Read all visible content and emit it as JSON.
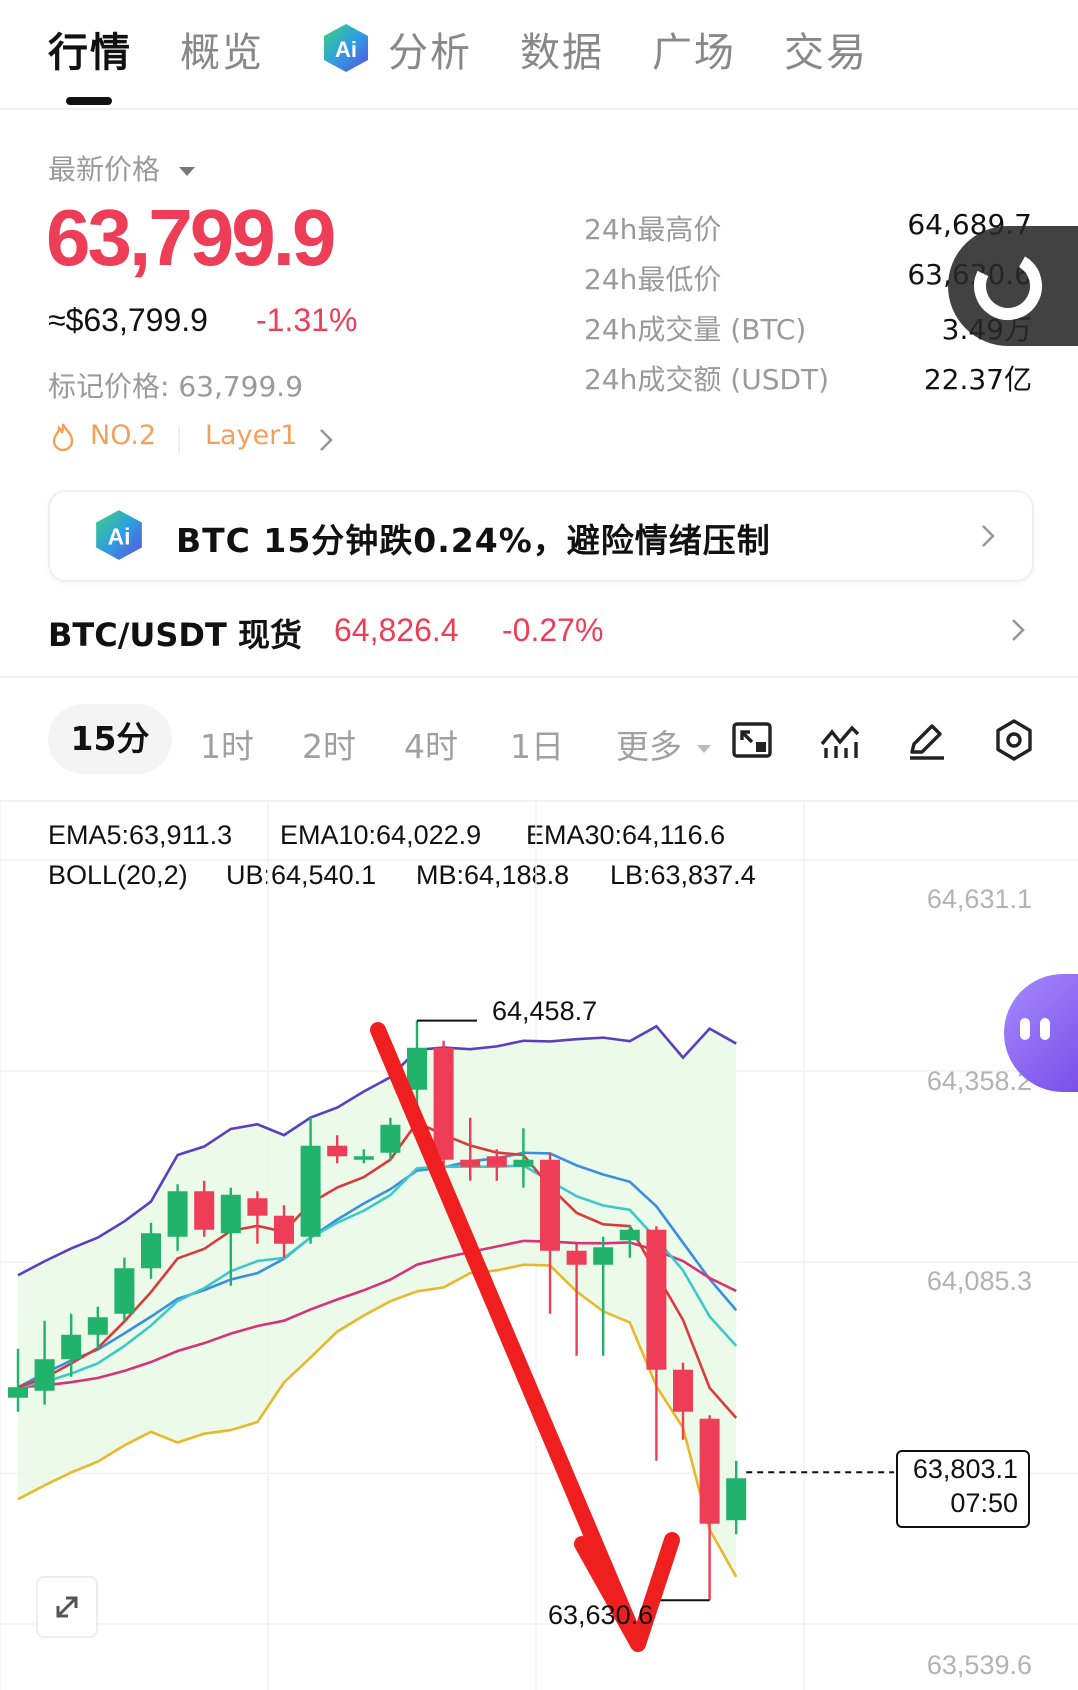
{
  "nav": {
    "tabs": [
      "行情",
      "概览",
      "分析",
      "数据",
      "广场",
      "交易"
    ],
    "active": "行情"
  },
  "price": {
    "latest_label": "最新价格",
    "last": "63,799.9",
    "usd": "≈$63,799.9",
    "change": "-1.31%",
    "mark": "标记价格: 63,799.9",
    "rank": "NO.2",
    "category": "Layer1"
  },
  "stats": [
    {
      "label": "24h最高价",
      "value": "64,689.7"
    },
    {
      "label": "24h最低价",
      "value": "63,630.6"
    },
    {
      "label": "24h成交量 (BTC)",
      "value": "3.49万"
    },
    {
      "label": "24h成交额 (USDT)",
      "value": "22.37亿"
    }
  ],
  "ai_banner": {
    "text": "BTC 15分钟跌0.24%，避险情绪压制"
  },
  "pair": {
    "name": "BTC/USDT 现货",
    "price": "64,826.4",
    "change": "-0.27%"
  },
  "intervals": [
    "15分",
    "1时",
    "2时",
    "4时",
    "1日",
    "更多"
  ],
  "active_interval": "15分",
  "indicators": {
    "ema5": "EMA5:63,911.3",
    "ema10": "EMA10:64,022.9",
    "ema30": "EMA30:64,116.6",
    "boll": "BOLL(20,2)",
    "ub": "UB:64,540.1",
    "mb": "MB:64,188.8",
    "lb": "LB:63,837.4"
  },
  "colors": {
    "up": "#21b26b",
    "down": "#ee3d57",
    "ema5": "#d93a3a",
    "ema10": "#3dc9c9",
    "ema30": "#d6337a",
    "boll": "#e0a431",
    "ub": "#5b3fbf",
    "mb": "#3a8fe0",
    "lb": "#e8b82a",
    "arrow": "#f01f1f"
  },
  "chart_data": {
    "type": "candlestick",
    "y_axis_ticks": [
      "64,631.1",
      "64,358.2",
      "64,085.3",
      "63,539.6"
    ],
    "high_marker": "64,458.7",
    "low_marker": "63,630.6",
    "current_price": "63,803.1",
    "countdown": "07:50",
    "candles": [
      {
        "o": 63920,
        "h": 63990,
        "c": 63935,
        "l": 63900
      },
      {
        "o": 63930,
        "h": 64030,
        "c": 63975,
        "l": 63910
      },
      {
        "o": 63975,
        "h": 64040,
        "c": 64010,
        "l": 63950
      },
      {
        "o": 64010,
        "h": 64050,
        "c": 64035,
        "l": 63990
      },
      {
        "o": 64040,
        "h": 64120,
        "c": 64105,
        "l": 64030
      },
      {
        "o": 64105,
        "h": 64170,
        "c": 64155,
        "l": 64090
      },
      {
        "o": 64150,
        "h": 64225,
        "c": 64215,
        "l": 64130
      },
      {
        "o": 64215,
        "h": 64230,
        "c": 64160,
        "l": 64150
      },
      {
        "o": 64155,
        "h": 64220,
        "c": 64210,
        "l": 64080
      },
      {
        "o": 64205,
        "h": 64215,
        "c": 64180,
        "l": 64140
      },
      {
        "o": 64180,
        "h": 64195,
        "c": 64140,
        "l": 64120
      },
      {
        "o": 64150,
        "h": 64320,
        "c": 64280,
        "l": 64140
      },
      {
        "o": 64280,
        "h": 64295,
        "c": 64265,
        "l": 64255
      },
      {
        "o": 64260,
        "h": 64275,
        "c": 64265,
        "l": 64255
      },
      {
        "o": 64270,
        "h": 64320,
        "c": 64310,
        "l": 64260
      },
      {
        "o": 64360,
        "h": 64458.7,
        "c": 64420,
        "l": 64300
      },
      {
        "o": 64420,
        "h": 64430,
        "c": 64260,
        "l": 64240
      },
      {
        "o": 64260,
        "h": 64320,
        "c": 64250,
        "l": 64230
      },
      {
        "o": 64265,
        "h": 64275,
        "c": 64250,
        "l": 64230
      },
      {
        "o": 64250,
        "h": 64305,
        "c": 64260,
        "l": 64220
      },
      {
        "o": 64260,
        "h": 64270,
        "c": 64130,
        "l": 64040
      },
      {
        "o": 64130,
        "h": 64140,
        "c": 64110,
        "l": 63980
      },
      {
        "o": 64110,
        "h": 64150,
        "c": 64135,
        "l": 63980
      },
      {
        "o": 64145,
        "h": 64165,
        "c": 64160,
        "l": 64120
      },
      {
        "o": 64160,
        "h": 64165,
        "c": 63960,
        "l": 63830
      },
      {
        "o": 63960,
        "h": 63970,
        "c": 63900,
        "l": 63860
      },
      {
        "o": 63890,
        "h": 63895,
        "c": 63740,
        "l": 63630.6
      },
      {
        "o": 63745,
        "h": 63830,
        "c": 63805,
        "l": 63725
      }
    ]
  }
}
